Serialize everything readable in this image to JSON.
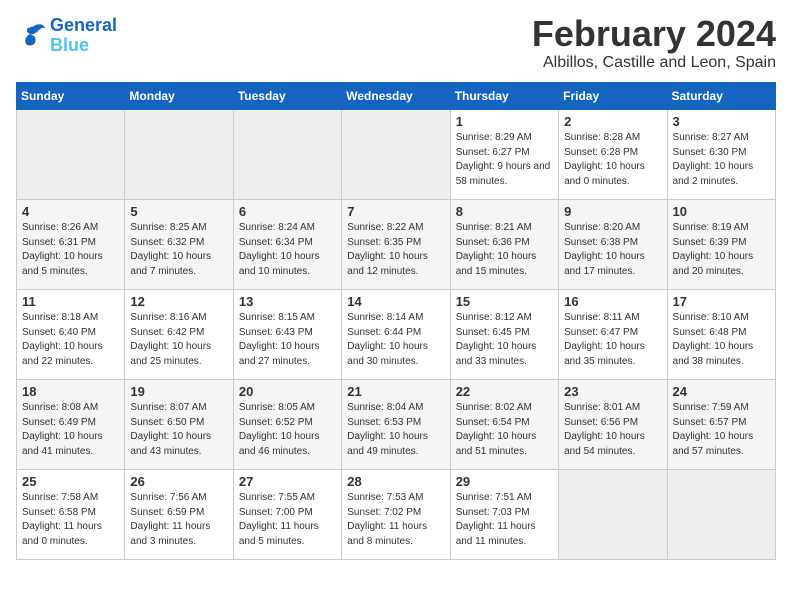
{
  "logo": {
    "line1": "General",
    "line2": "Blue"
  },
  "title": "February 2024",
  "location": "Albillos, Castille and Leon, Spain",
  "days_of_week": [
    "Sunday",
    "Monday",
    "Tuesday",
    "Wednesday",
    "Thursday",
    "Friday",
    "Saturday"
  ],
  "weeks": [
    [
      {
        "num": "",
        "empty": true
      },
      {
        "num": "",
        "empty": true
      },
      {
        "num": "",
        "empty": true
      },
      {
        "num": "",
        "empty": true
      },
      {
        "num": "1",
        "sunrise": "8:29 AM",
        "sunset": "6:27 PM",
        "daylight": "9 hours and 58 minutes."
      },
      {
        "num": "2",
        "sunrise": "8:28 AM",
        "sunset": "6:28 PM",
        "daylight": "10 hours and 0 minutes."
      },
      {
        "num": "3",
        "sunrise": "8:27 AM",
        "sunset": "6:30 PM",
        "daylight": "10 hours and 2 minutes."
      }
    ],
    [
      {
        "num": "4",
        "sunrise": "8:26 AM",
        "sunset": "6:31 PM",
        "daylight": "10 hours and 5 minutes."
      },
      {
        "num": "5",
        "sunrise": "8:25 AM",
        "sunset": "6:32 PM",
        "daylight": "10 hours and 7 minutes."
      },
      {
        "num": "6",
        "sunrise": "8:24 AM",
        "sunset": "6:34 PM",
        "daylight": "10 hours and 10 minutes."
      },
      {
        "num": "7",
        "sunrise": "8:22 AM",
        "sunset": "6:35 PM",
        "daylight": "10 hours and 12 minutes."
      },
      {
        "num": "8",
        "sunrise": "8:21 AM",
        "sunset": "6:36 PM",
        "daylight": "10 hours and 15 minutes."
      },
      {
        "num": "9",
        "sunrise": "8:20 AM",
        "sunset": "6:38 PM",
        "daylight": "10 hours and 17 minutes."
      },
      {
        "num": "10",
        "sunrise": "8:19 AM",
        "sunset": "6:39 PM",
        "daylight": "10 hours and 20 minutes."
      }
    ],
    [
      {
        "num": "11",
        "sunrise": "8:18 AM",
        "sunset": "6:40 PM",
        "daylight": "10 hours and 22 minutes."
      },
      {
        "num": "12",
        "sunrise": "8:16 AM",
        "sunset": "6:42 PM",
        "daylight": "10 hours and 25 minutes."
      },
      {
        "num": "13",
        "sunrise": "8:15 AM",
        "sunset": "6:43 PM",
        "daylight": "10 hours and 27 minutes."
      },
      {
        "num": "14",
        "sunrise": "8:14 AM",
        "sunset": "6:44 PM",
        "daylight": "10 hours and 30 minutes."
      },
      {
        "num": "15",
        "sunrise": "8:12 AM",
        "sunset": "6:45 PM",
        "daylight": "10 hours and 33 minutes."
      },
      {
        "num": "16",
        "sunrise": "8:11 AM",
        "sunset": "6:47 PM",
        "daylight": "10 hours and 35 minutes."
      },
      {
        "num": "17",
        "sunrise": "8:10 AM",
        "sunset": "6:48 PM",
        "daylight": "10 hours and 38 minutes."
      }
    ],
    [
      {
        "num": "18",
        "sunrise": "8:08 AM",
        "sunset": "6:49 PM",
        "daylight": "10 hours and 41 minutes."
      },
      {
        "num": "19",
        "sunrise": "8:07 AM",
        "sunset": "6:50 PM",
        "daylight": "10 hours and 43 minutes."
      },
      {
        "num": "20",
        "sunrise": "8:05 AM",
        "sunset": "6:52 PM",
        "daylight": "10 hours and 46 minutes."
      },
      {
        "num": "21",
        "sunrise": "8:04 AM",
        "sunset": "6:53 PM",
        "daylight": "10 hours and 49 minutes."
      },
      {
        "num": "22",
        "sunrise": "8:02 AM",
        "sunset": "6:54 PM",
        "daylight": "10 hours and 51 minutes."
      },
      {
        "num": "23",
        "sunrise": "8:01 AM",
        "sunset": "6:56 PM",
        "daylight": "10 hours and 54 minutes."
      },
      {
        "num": "24",
        "sunrise": "7:59 AM",
        "sunset": "6:57 PM",
        "daylight": "10 hours and 57 minutes."
      }
    ],
    [
      {
        "num": "25",
        "sunrise": "7:58 AM",
        "sunset": "6:58 PM",
        "daylight": "11 hours and 0 minutes."
      },
      {
        "num": "26",
        "sunrise": "7:56 AM",
        "sunset": "6:59 PM",
        "daylight": "11 hours and 3 minutes."
      },
      {
        "num": "27",
        "sunrise": "7:55 AM",
        "sunset": "7:00 PM",
        "daylight": "11 hours and 5 minutes."
      },
      {
        "num": "28",
        "sunrise": "7:53 AM",
        "sunset": "7:02 PM",
        "daylight": "11 hours and 8 minutes."
      },
      {
        "num": "29",
        "sunrise": "7:51 AM",
        "sunset": "7:03 PM",
        "daylight": "11 hours and 11 minutes."
      },
      {
        "num": "",
        "empty": true
      },
      {
        "num": "",
        "empty": true
      }
    ]
  ]
}
